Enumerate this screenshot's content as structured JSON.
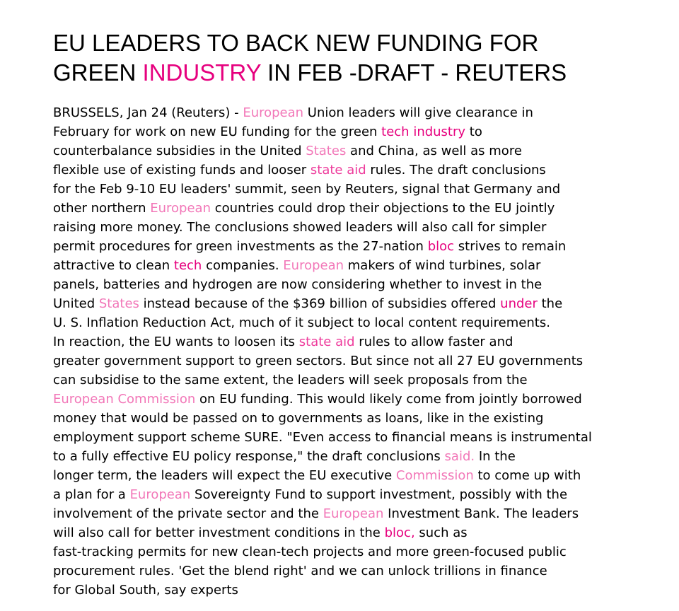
{
  "article": {
    "headline_lines": [
      [
        {
          "t": "EU LEADERS TO BACK NEW FUNDING FOR",
          "hl": ""
        }
      ],
      [
        {
          "t": "GREEN ",
          "hl": ""
        },
        {
          "t": "INDUSTRY",
          "hl": "strong"
        },
        {
          "t": " IN FEB -DRAFT - REUTERS",
          "hl": ""
        }
      ]
    ],
    "body_lines": [
      [
        {
          "t": "BRUSSELS, Jan 24 (Reuters) - ",
          "hl": ""
        },
        {
          "t": "European",
          "hl": "light"
        },
        {
          "t": " Union leaders will give clearance in",
          "hl": ""
        }
      ],
      [
        {
          "t": "February for work on new EU funding for the green ",
          "hl": ""
        },
        {
          "t": "tech industry",
          "hl": "strong"
        },
        {
          "t": " to",
          "hl": ""
        }
      ],
      [
        {
          "t": "counterbalance subsidies in the United ",
          "hl": ""
        },
        {
          "t": "States",
          "hl": "light"
        },
        {
          "t": " and China, as well as more",
          "hl": ""
        }
      ],
      [
        {
          "t": "flexible use of existing funds and looser ",
          "hl": ""
        },
        {
          "t": "state aid",
          "hl": "medium"
        },
        {
          "t": " rules. The draft conclusions",
          "hl": ""
        }
      ],
      [
        {
          "t": "for the Feb 9-10 EU leaders' summit, seen by Reuters, signal that Germany and",
          "hl": ""
        }
      ],
      [
        {
          "t": "other northern ",
          "hl": ""
        },
        {
          "t": "European",
          "hl": "light"
        },
        {
          "t": " countries could drop their objections to the EU jointly",
          "hl": ""
        }
      ],
      [
        {
          "t": "raising more money. The conclusions showed leaders will also call for simpler",
          "hl": ""
        }
      ],
      [
        {
          "t": "permit procedures for green investments as the 27-nation ",
          "hl": ""
        },
        {
          "t": "bloc",
          "hl": "strong"
        },
        {
          "t": " strives to remain",
          "hl": ""
        }
      ],
      [
        {
          "t": "attractive to clean ",
          "hl": ""
        },
        {
          "t": "tech",
          "hl": "strong"
        },
        {
          "t": " companies. ",
          "hl": ""
        },
        {
          "t": "European",
          "hl": "light"
        },
        {
          "t": " makers of wind turbines, solar",
          "hl": ""
        }
      ],
      [
        {
          "t": "panels, batteries and hydrogen are now considering whether to invest in the",
          "hl": ""
        }
      ],
      [
        {
          "t": "United ",
          "hl": ""
        },
        {
          "t": "States",
          "hl": "light"
        },
        {
          "t": " instead because of the $369 billion of subsidies offered ",
          "hl": ""
        },
        {
          "t": "under",
          "hl": "strong"
        },
        {
          "t": " the",
          "hl": ""
        }
      ],
      [
        {
          "t": "U. S. Inflation Reduction Act, much of it subject to local content requirements.",
          "hl": ""
        }
      ],
      [
        {
          "t": "In reaction, the EU wants to loosen its ",
          "hl": ""
        },
        {
          "t": "state aid",
          "hl": "medium"
        },
        {
          "t": " rules to allow faster and",
          "hl": ""
        }
      ],
      [
        {
          "t": "greater government support to green sectors. But since not all 27 EU governments",
          "hl": ""
        }
      ],
      [
        {
          "t": "can subsidise to the same extent, the leaders will seek proposals from the",
          "hl": ""
        }
      ],
      [
        {
          "t": "European Commission",
          "hl": "light"
        },
        {
          "t": " on EU funding. This would likely come from jointly borrowed",
          "hl": ""
        }
      ],
      [
        {
          "t": "money that would be passed on to governments as loans, like in the existing",
          "hl": ""
        }
      ],
      [
        {
          "t": "employment support scheme SURE. \"Even access to financial means is instrumental",
          "hl": ""
        }
      ],
      [
        {
          "t": "to a fully effective EU policy response,\" the draft conclusions ",
          "hl": ""
        },
        {
          "t": "said.",
          "hl": "light"
        },
        {
          "t": " In the",
          "hl": ""
        }
      ],
      [
        {
          "t": "longer term, the leaders will expect the EU executive ",
          "hl": ""
        },
        {
          "t": "Commission",
          "hl": "light"
        },
        {
          "t": " to come up with",
          "hl": ""
        }
      ],
      [
        {
          "t": "a plan for a ",
          "hl": ""
        },
        {
          "t": "European",
          "hl": "light"
        },
        {
          "t": " Sovereignty Fund to support investment, possibly with the",
          "hl": ""
        }
      ],
      [
        {
          "t": "involvement of the private sector and the ",
          "hl": ""
        },
        {
          "t": "European",
          "hl": "light"
        },
        {
          "t": " Investment Bank. The leaders",
          "hl": ""
        }
      ],
      [
        {
          "t": "will also call for better investment conditions in the ",
          "hl": ""
        },
        {
          "t": "bloc,",
          "hl": "strong"
        },
        {
          "t": " such as",
          "hl": ""
        }
      ],
      [
        {
          "t": "fast-tracking permits for new clean-tech projects and more green-focused public",
          "hl": ""
        }
      ],
      [
        {
          "t": "procurement rules. 'Get the blend right' and we can unlock trillions in finance",
          "hl": ""
        }
      ],
      [
        {
          "t": "for Global South, say experts",
          "hl": ""
        }
      ]
    ]
  },
  "colors": {
    "text": "#000000",
    "highlight_strong": "#e6007e",
    "highlight_medium": "#ee3c9c",
    "highlight_light": "#f277b8",
    "background": "#ffffff"
  }
}
